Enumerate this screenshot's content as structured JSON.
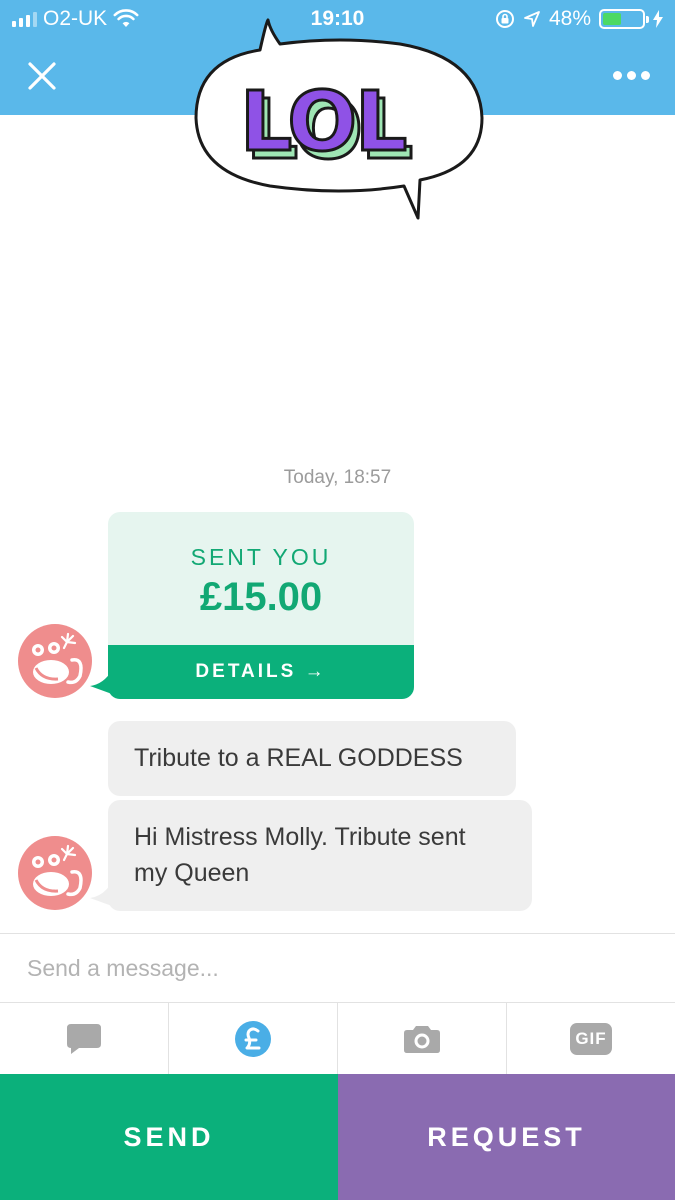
{
  "status_bar": {
    "carrier": "O2-UK",
    "time": "19:10",
    "battery_percent": "48%",
    "battery_level": 0.48,
    "battery_color": "#4cd964"
  },
  "header": {
    "close_icon": "close-icon",
    "more_icon": "more-dots-icon",
    "background": "#5ab8ea"
  },
  "sticker": {
    "text": "LOL",
    "colors": {
      "letters": "#8f52e6",
      "shadow": "#9fe6b4"
    }
  },
  "conversation": {
    "timestamp": "Today, 18:57",
    "payment": {
      "label": "SENT YOU",
      "amount": "£15.00",
      "details_label": "DETAILS →"
    },
    "messages": [
      {
        "text": "Tribute to a REAL GODDESS"
      },
      {
        "line1": "Hi Mistress Molly. Tribute sent",
        "line2": "my Queen"
      }
    ]
  },
  "composer": {
    "placeholder": "Send a message..."
  },
  "toolbar": {
    "tools": [
      "chat-bubble-icon",
      "pound-currency-icon",
      "camera-icon",
      "gif-icon"
    ],
    "gif_label": "GIF",
    "active_color": "#4aaee6"
  },
  "actions": {
    "send_label": "SEND",
    "request_label": "REQUEST",
    "send_color": "#0bb07b",
    "request_color": "#8a6bb1"
  }
}
